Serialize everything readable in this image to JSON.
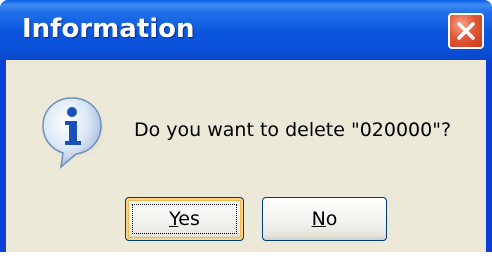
{
  "dialog": {
    "title": "Information",
    "message": "Do you want to delete \"020000\"?",
    "icon": "information-icon",
    "close_icon": "close-icon"
  },
  "buttons": {
    "yes": {
      "mnemonic": "Y",
      "rest": "es"
    },
    "no": {
      "mnemonic": "N",
      "rest": "o"
    }
  },
  "colors": {
    "titlebar": "#0b56de",
    "client": "#ece9d8",
    "close_button": "#e2593a"
  }
}
